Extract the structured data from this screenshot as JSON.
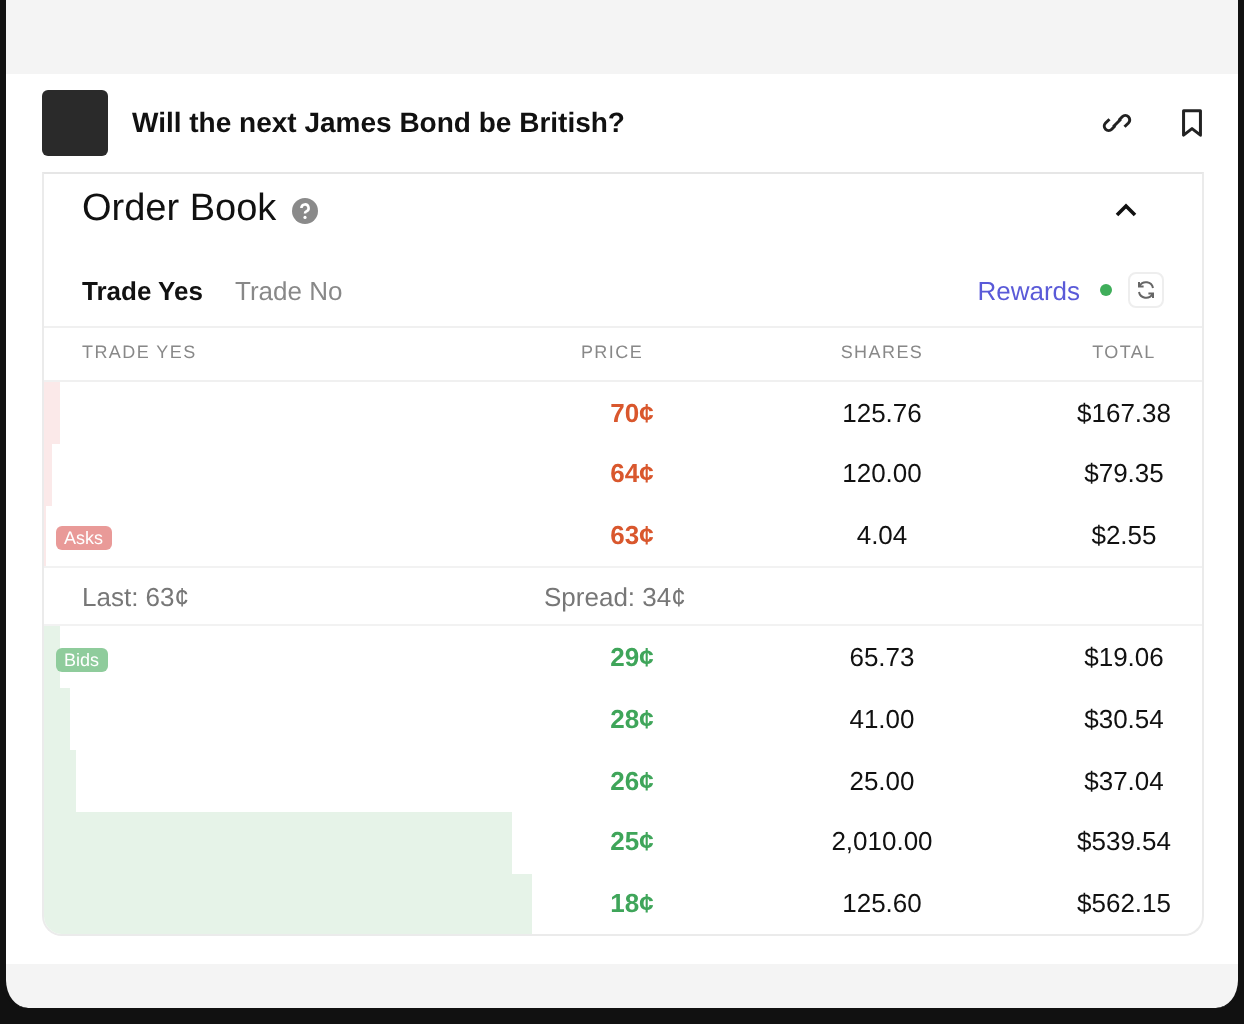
{
  "market": {
    "title": "Will the next James Bond be British?"
  },
  "order_book": {
    "title": "Order Book",
    "expanded": true,
    "tabs": [
      {
        "label": "Trade Yes",
        "selected": true
      },
      {
        "label": "Trade No",
        "selected": false
      }
    ],
    "rewards": {
      "label": "Rewards",
      "active": true
    },
    "columns": [
      "TRADE YES",
      "PRICE",
      "SHARES",
      "TOTAL"
    ],
    "asks_label": "Asks",
    "asks": [
      {
        "price": "70¢",
        "shares": "125.76",
        "total": "$167.38",
        "level": 0.014
      },
      {
        "price": "64¢",
        "shares": "120.00",
        "total": "$79.35",
        "level": 0.007
      },
      {
        "price": "63¢",
        "shares": "4.04",
        "total": "$2.55",
        "level": 0.001
      }
    ],
    "last": "Last: 63¢",
    "spread": "Spread: 34¢",
    "bids_label": "Bids",
    "bids": [
      {
        "price": "29¢",
        "shares": "65.73",
        "total": "$19.06",
        "level": 0.014
      },
      {
        "price": "28¢",
        "shares": "41.00",
        "total": "$30.54",
        "level": 0.022
      },
      {
        "price": "26¢",
        "shares": "25.00",
        "total": "$37.04",
        "level": 0.027
      },
      {
        "price": "25¢",
        "shares": "2,010.00",
        "total": "$539.54",
        "level": 0.405
      },
      {
        "price": "18¢",
        "shares": "125.60",
        "total": "$562.15",
        "level": 0.422
      }
    ]
  }
}
